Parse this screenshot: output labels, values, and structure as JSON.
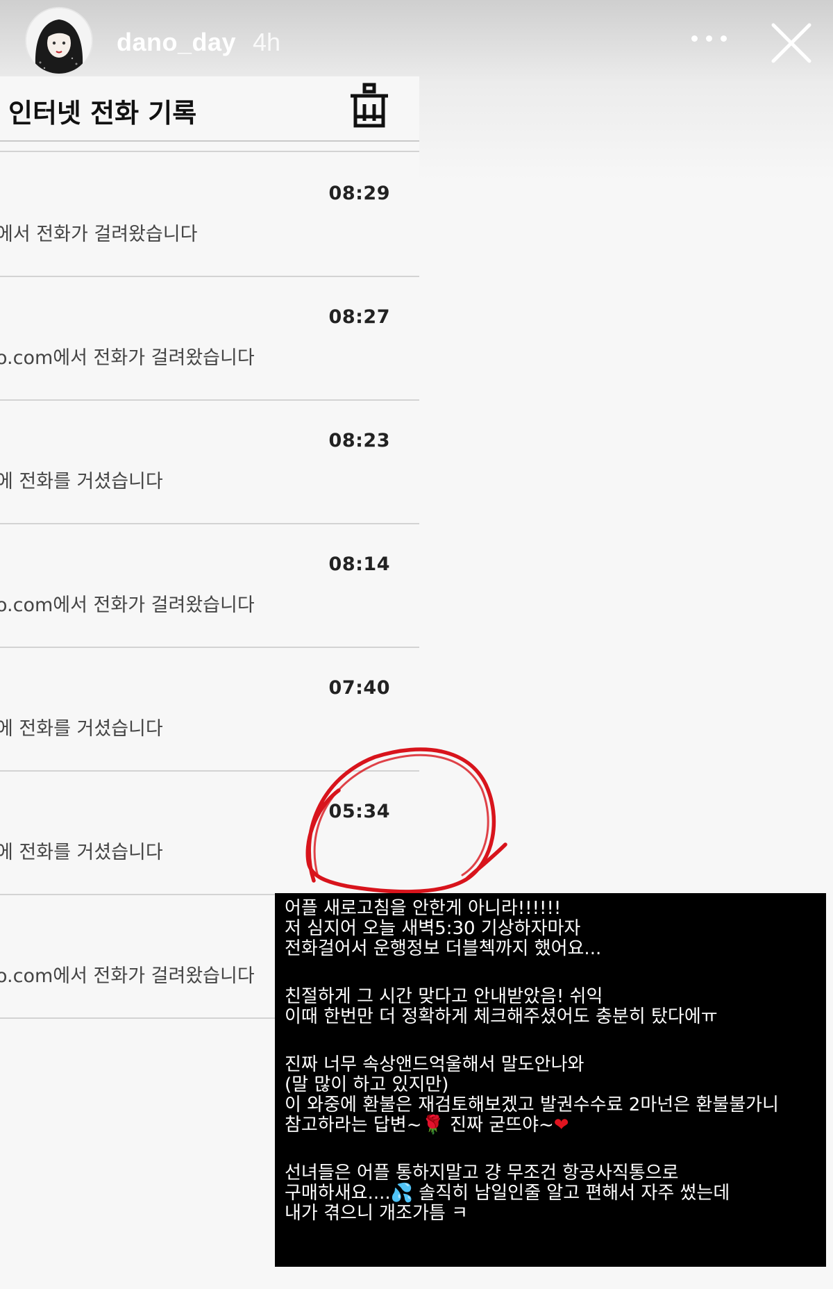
{
  "story": {
    "username": "dano_day",
    "time_ago": "4h",
    "icons": {
      "more": "more-dots-icon",
      "close": "close-icon"
    }
  },
  "app": {
    "title": "인터넷 전화 기록",
    "trash_icon": "trash-icon",
    "calls": [
      {
        "time": "08:29",
        "description": "에서 전화가 걸려왔습니다"
      },
      {
        "time": "08:27",
        "description": "o.com에서 전화가 걸려왔습니다"
      },
      {
        "time": "08:23",
        "description": "에 전화를 거셨습니다"
      },
      {
        "time": "08:14",
        "description": "o.com에서 전화가 걸려왔습니다"
      },
      {
        "time": "07:40",
        "description": "에 전화를 거셨습니다"
      },
      {
        "time": "05:34",
        "description": "에 전화를 거셨습니다"
      },
      {
        "time": "",
        "description": "o.com에서 전화가 걸려왔습니다"
      }
    ]
  },
  "annotation": {
    "color": "#d8141c"
  },
  "caption": {
    "p1": [
      "어플 새로고침을 안한게 아니라!!!!!!",
      "저 심지어 오늘 새벽5:30 기상하자마자",
      "전화걸어서 운행정보 더블첵까지 했어요..."
    ],
    "p2": [
      "친절하게 그 시간 맞다고 안내받았음! 쉬익",
      "이때 한번만 더 정확하게 체크해주셨어도 충분히 탔다에ㅠ"
    ],
    "p3": [
      "진짜 너무 속상앤드억울해서 말도안나와",
      "(말 많이 하고 있지만)",
      "이 와중에 환불은 재검토해보겠고 발권수수료 2마넌은 환불불가니"
    ],
    "p3_last_a": "참고하라는  답변~",
    "p3_last_b": " 진짜 굳뜨야~",
    "p4_line1": "선녀들은 어플 통하지말고 걍 무조건 항공사직통으로",
    "p4_line2_a": "구매하새요....",
    "p4_line2_b": " 솔직히 남일인줄 알고 편해서 자주 썼는데",
    "p4_line3": "내가 겪으니 개조가틈 ㅋ",
    "emoji": {
      "rose": "🌹",
      "heart": "❤",
      "drops": "💦"
    }
  }
}
